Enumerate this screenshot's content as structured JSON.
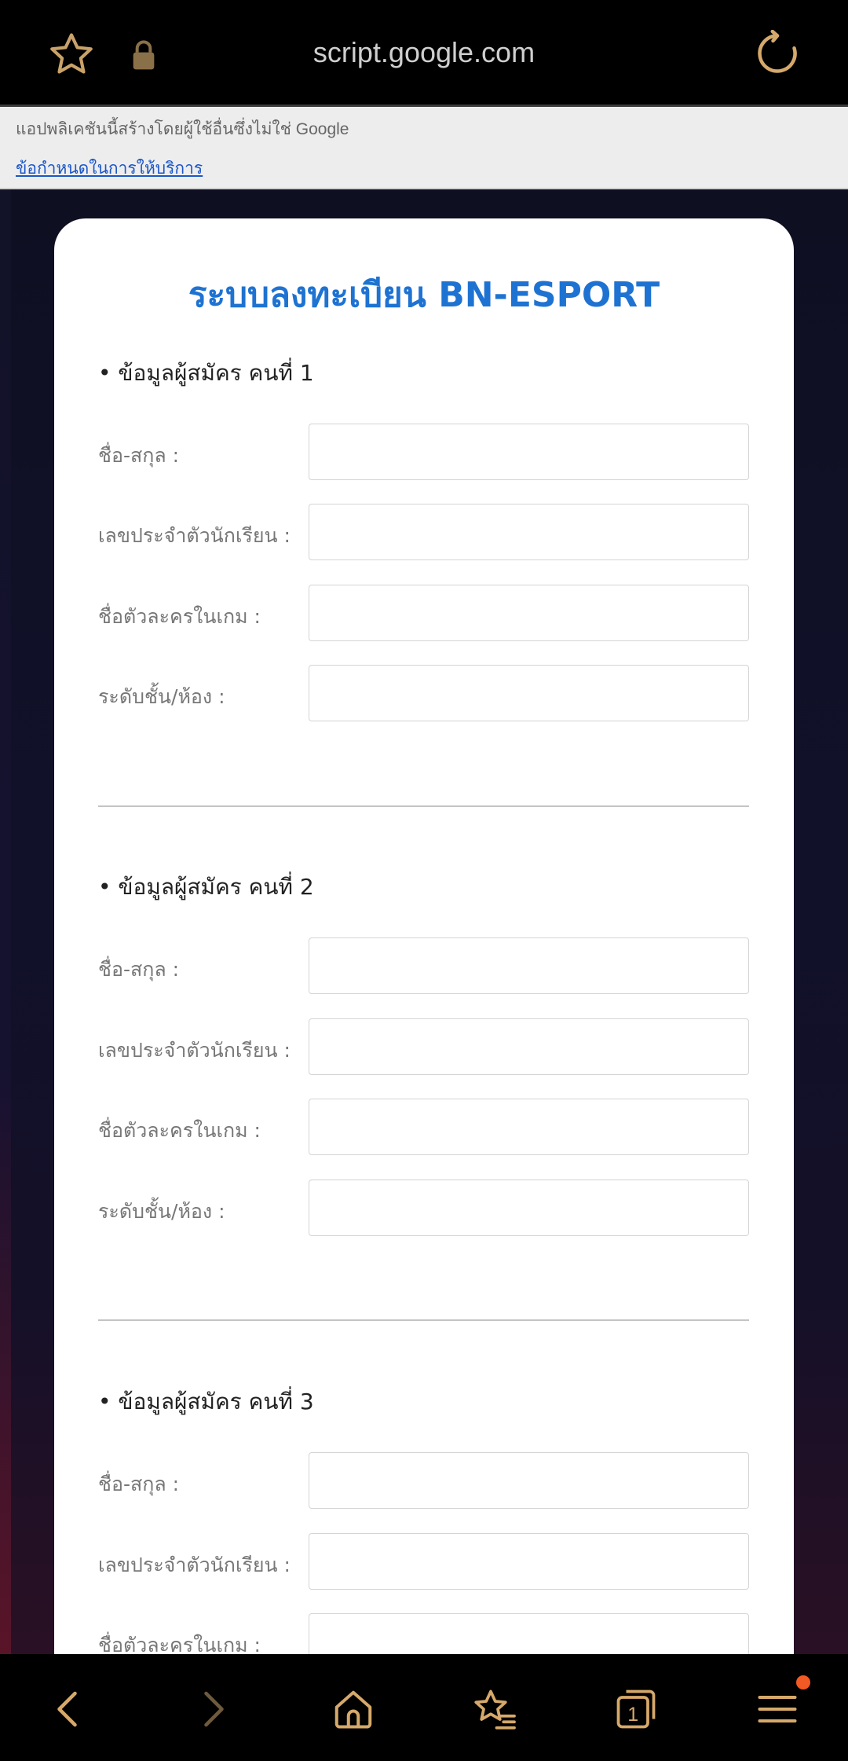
{
  "browser": {
    "url": "script.google.com",
    "tab_count": "1",
    "accent_color": "#d6a96a",
    "icons": [
      "star-icon",
      "lock-icon",
      "reload-icon",
      "back-icon",
      "forward-icon",
      "home-icon",
      "bookmarks-icon",
      "tabs-icon",
      "menu-icon"
    ]
  },
  "notice": {
    "message": "แอปพลิเคชันนี้สร้างโดยผู้ใช้อื่นซึ่งไม่ใช่ Google",
    "terms_link": "ข้อกำหนดในการให้บริการ"
  },
  "form": {
    "title": "ระบบลงทะเบียน BN-ESPORT",
    "title_color": "#1e73d2",
    "sections": [
      {
        "heading": "• ข้อมูลผู้สมัคร คนที่ 1",
        "fields": [
          {
            "label": "ชื่อ-สกุล :",
            "value": ""
          },
          {
            "label": "เลขประจำตัวนักเรียน :",
            "value": ""
          },
          {
            "label": "ชื่อตัวละครในเกม :",
            "value": ""
          },
          {
            "label": "ระดับชั้น/ห้อง :",
            "value": ""
          }
        ]
      },
      {
        "heading": "• ข้อมูลผู้สมัคร คนที่ 2",
        "fields": [
          {
            "label": "ชื่อ-สกุล :",
            "value": ""
          },
          {
            "label": "เลขประจำตัวนักเรียน :",
            "value": ""
          },
          {
            "label": "ชื่อตัวละครในเกม :",
            "value": ""
          },
          {
            "label": "ระดับชั้น/ห้อง :",
            "value": ""
          }
        ]
      },
      {
        "heading": "• ข้อมูลผู้สมัคร คนที่ 3",
        "fields": [
          {
            "label": "ชื่อ-สกุล :",
            "value": ""
          },
          {
            "label": "เลขประจำตัวนักเรียน :",
            "value": ""
          },
          {
            "label": "ชื่อตัวละครในเกม :",
            "value": ""
          }
        ]
      }
    ]
  }
}
